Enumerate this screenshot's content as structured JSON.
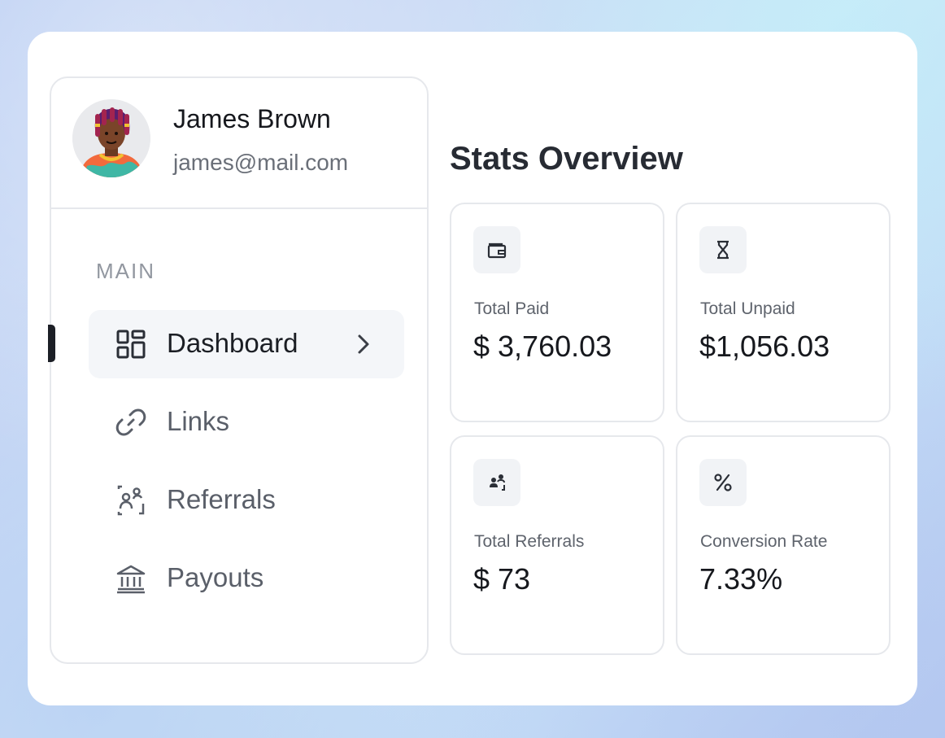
{
  "profile": {
    "name": "James Brown",
    "email": "james@mail.com"
  },
  "sidebar": {
    "section_label": "MAIN",
    "items": [
      {
        "label": "Dashboard",
        "icon": "dashboard-icon",
        "active": true
      },
      {
        "label": "Links",
        "icon": "link-icon",
        "active": false
      },
      {
        "label": "Referrals",
        "icon": "referrals-icon",
        "active": false
      },
      {
        "label": "Payouts",
        "icon": "bank-icon",
        "active": false
      }
    ]
  },
  "stats": {
    "title": "Stats Overview",
    "cards": [
      {
        "label": "Total Paid",
        "value": "$ 3,760.03",
        "icon": "wallet-icon"
      },
      {
        "label": "Total Unpaid",
        "value": "$1,056.03",
        "icon": "hourglass-icon"
      },
      {
        "label": "Total Referrals",
        "value": "$ 73",
        "icon": "users-icon"
      },
      {
        "label": "Conversion Rate",
        "value": "7.33%",
        "icon": "percent-icon"
      }
    ]
  },
  "colors": {
    "active_marker": "#1c1f26",
    "active_bg": "#f4f6f9",
    "border": "#e6e8ec",
    "icon_box": "#f1f3f6"
  }
}
